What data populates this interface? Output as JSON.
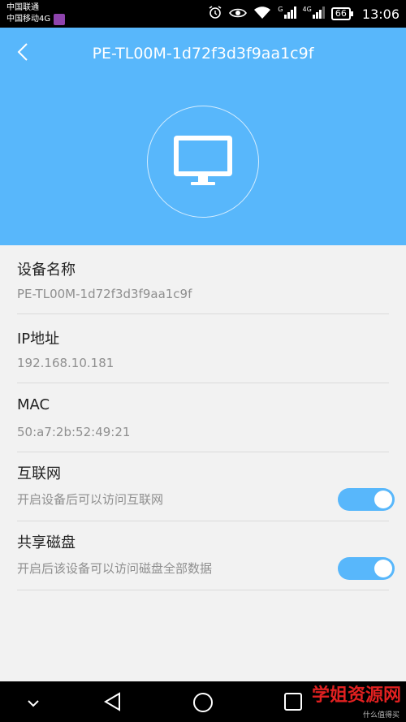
{
  "status_bar": {
    "carrier_1": "中国联通",
    "carrier_2": "中国移动4G",
    "net_1": "G",
    "net_2": "4G",
    "battery": "66",
    "time": "13:06"
  },
  "header": {
    "title": "PE-TL00M-1d72f3d3f9aa1c9f",
    "device_icon": "monitor-icon"
  },
  "details": [
    {
      "label": "设备名称",
      "value": "PE-TL00M-1d72f3d3f9aa1c9f"
    },
    {
      "label": "IP地址",
      "value": "192.168.10.181"
    },
    {
      "label": "MAC",
      "value": "50:a7:2b:52:49:21"
    }
  ],
  "toggles": [
    {
      "label": "互联网",
      "description": "开启设备后可以访问互联网",
      "on": true
    },
    {
      "label": "共享磁盘",
      "description": "开启后该设备可以访问磁盘全部数据",
      "on": true
    }
  ],
  "watermark": {
    "text": "学姐资源网",
    "sub": "什么值得买"
  },
  "colors": {
    "accent": "#58b7fb",
    "background": "#f2f2f2",
    "nav": "#000000"
  }
}
